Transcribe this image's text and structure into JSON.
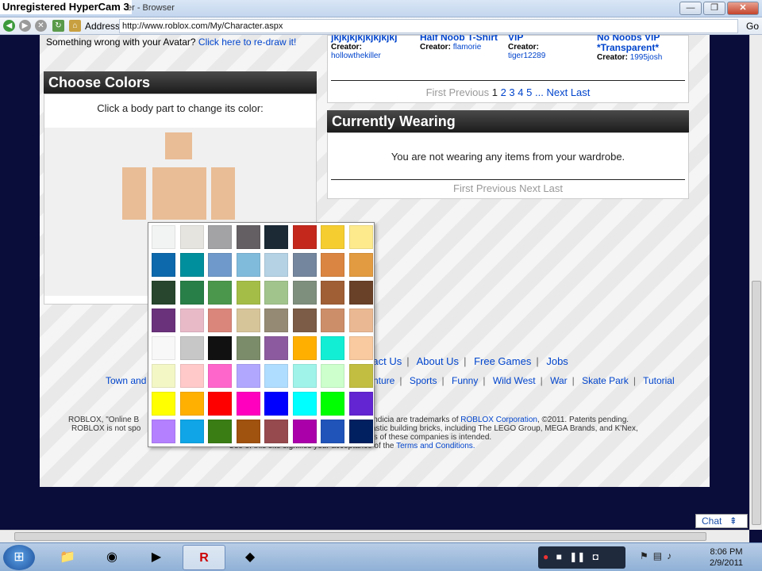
{
  "window": {
    "hypercam_label": "Unregistered HyperCam 3",
    "title_fragment": "er - Browser",
    "min_icon": "minimize-icon",
    "max_icon": "maximize-icon",
    "close_icon": "close-icon"
  },
  "address_bar": {
    "label": "Address",
    "url": "http://www.roblox.com/My/Character.aspx",
    "go_label": "Go"
  },
  "avatar_message": {
    "text": "Something wrong with your Avatar?",
    "link": "Click here to re-draw it!"
  },
  "choose_colors": {
    "title": "Choose Colors",
    "hint": "Click a body part to change its color:"
  },
  "outfits": [
    {
      "title": "jkjkjkjkjkjkjkjkj",
      "creator_label": "Creator:",
      "creator": "hollowthekiller"
    },
    {
      "title": "Half Noob T-Shirt",
      "creator_label": "Creator:",
      "creator": "flamorie"
    },
    {
      "title": "VIP",
      "creator_label": "Creator:",
      "creator": "tiger12289"
    },
    {
      "title": "No Noobs VIP *Transparent*",
      "creator_label": "Creator:",
      "creator": "1995josh"
    }
  ],
  "outfits_pager": {
    "first": "First",
    "previous": "Previous",
    "pages": [
      "1",
      "2",
      "3",
      "4",
      "5"
    ],
    "ellipsis": "...",
    "next": "Next",
    "last": "Last"
  },
  "currently_wearing": {
    "title": "Currently Wearing",
    "message": "You are not wearing any items from your wardrobe.",
    "pager": "First Previous Next Last"
  },
  "footer": {
    "nav1": [
      "Contact Us",
      "About Us",
      "Free Games",
      "Jobs"
    ],
    "nav1_clipped_first": "tact Us",
    "nav2_left": "Town and",
    "nav2": [
      "nture",
      "Sports",
      "Funny",
      "Wild West",
      "War",
      "Skate Park",
      "Tutorial"
    ],
    "legal_line1_left": "ROBLOX, \"Online B",
    "legal_line1_right": "indicia are trademarks of",
    "legal_company": "ROBLOX Corporation",
    "legal_line1_end": ", ©2011. Patents pending.",
    "legal_line2_left": "ROBLOX is not spo",
    "legal_line2_right": "astic building bricks, including The LEGO Group, MEGA Brands, and K'Nex,",
    "legal_line3_right": "ts of these companies is intended.",
    "legal_line4": "Use of this site signifies your acceptance of the",
    "terms_link": "Terms and Conditions."
  },
  "chat": {
    "label": "Chat",
    "icon": "arrow-up-icon"
  },
  "palette": {
    "colors": [
      "#f2f3f3",
      "#e5e4df",
      "#a3a2a5",
      "#635f62",
      "#1b2a35",
      "#c4281c",
      "#f5cd30",
      "#fdea8d",
      "#0d69ac",
      "#008f9c",
      "#6e99ca",
      "#80bbdb",
      "#b4d2e4",
      "#74869d",
      "#da8541",
      "#e29b40",
      "#27462d",
      "#287f47",
      "#4b974b",
      "#a4bd47",
      "#a1c48c",
      "#7f8f7e",
      "#a05f35",
      "#694028",
      "#6b327c",
      "#e8bac8",
      "#da867a",
      "#d7c59a",
      "#958a73",
      "#7c5c46",
      "#cc8e69",
      "#eab892",
      "#f8f8f8",
      "#c7c7c7",
      "#111111",
      "#7b8c6a",
      "#8c5b9f",
      "#ffaf00",
      "#12eed4",
      "#f9c99f",
      "#f3f7c6",
      "#ffc9c9",
      "#ff66cc",
      "#b1a7ff",
      "#afddff",
      "#9ff3e9",
      "#ccffcc",
      "#c1be42",
      "#ffff00",
      "#ffb000",
      "#ff0000",
      "#ff00bf",
      "#0000ff",
      "#00ffff",
      "#00ff00",
      "#6225d1",
      "#b480ff",
      "#0fa5e6",
      "#3a7d15",
      "#a0520f",
      "#964a4e",
      "#aa00aa",
      "#2154b9",
      "#002060"
    ]
  },
  "body_colors": {
    "skin": "#e9bd96"
  },
  "taskbar": {
    "start_icon": "windows-logo-icon",
    "tasks": [
      "folder-icon",
      "chrome-icon",
      "media-player-icon",
      "roblox-icon",
      "roblox-studio-icon"
    ],
    "clock_time": "8:06 PM",
    "clock_date": "2/9/2011"
  }
}
